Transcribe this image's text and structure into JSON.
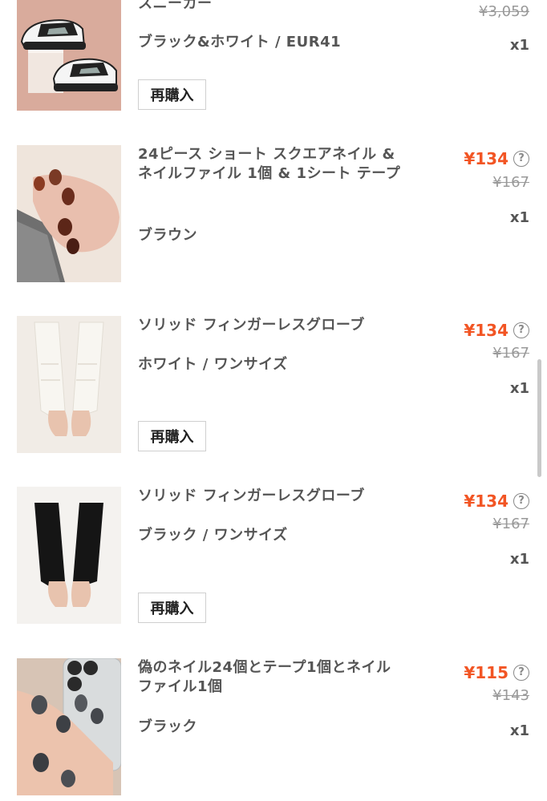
{
  "items": [
    {
      "title": "スニーカー",
      "variant": "ブラック&ホワイト / EUR41",
      "sale_price": "",
      "original_price": "¥3,059",
      "qty": "x1",
      "rebuy": "再購入"
    },
    {
      "title": "24ピース ショート スクエアネイル & ネイルファイル 1個 & 1シート テープ",
      "variant": "ブラウン",
      "sale_price": "¥134",
      "original_price": "¥167",
      "qty": "x1"
    },
    {
      "title": "ソリッド フィンガーレスグローブ",
      "variant": "ホワイト / ワンサイズ",
      "sale_price": "¥134",
      "original_price": "¥167",
      "qty": "x1",
      "rebuy": "再購入"
    },
    {
      "title": "ソリッド フィンガーレスグローブ",
      "variant": "ブラック / ワンサイズ",
      "sale_price": "¥134",
      "original_price": "¥167",
      "qty": "x1",
      "rebuy": "再購入"
    },
    {
      "title": "偽のネイル24個とテープ1個とネイルファイル1個",
      "variant": "ブラック",
      "sale_price": "¥115",
      "original_price": "¥143",
      "qty": "x1"
    }
  ],
  "help_icon_glyph": "?",
  "colors": {
    "sale": "#f25524",
    "strike": "#999999"
  }
}
